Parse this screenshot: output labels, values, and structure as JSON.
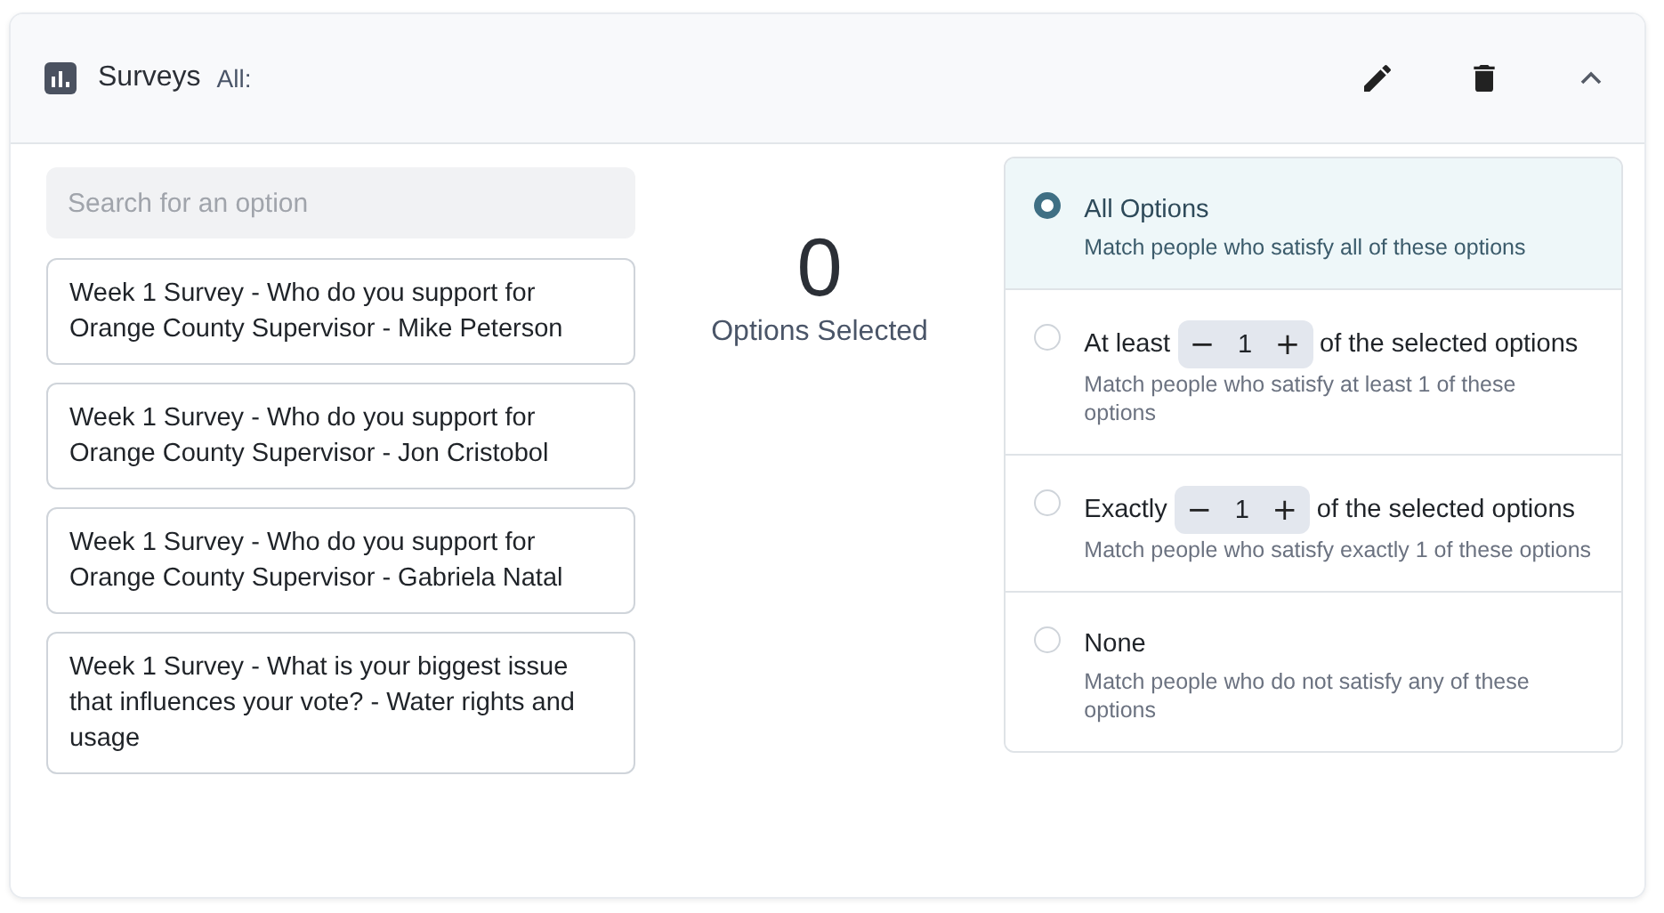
{
  "header": {
    "title": "Surveys",
    "filter": "All:"
  },
  "search": {
    "placeholder": "Search for an option"
  },
  "options": [
    {
      "label": "Week 1 Survey - Who do you support for Orange County Supervisor - Mike Peterson"
    },
    {
      "label": "Week 1 Survey - Who do you support for Orange County Supervisor - Jon Cristobol"
    },
    {
      "label": "Week 1 Survey - Who do you support for Orange County Supervisor - Gabriela Natal"
    },
    {
      "label": "Week 1 Survey - What is your biggest issue that influences your vote? - Water rights and usage"
    }
  ],
  "summary": {
    "count": "0",
    "label": "Options Selected"
  },
  "match_modes": [
    {
      "kind": "plain",
      "selected": true,
      "label": "All Options",
      "description": "Match people who satisfy all of these options"
    },
    {
      "kind": "stepper",
      "selected": false,
      "label": "At least",
      "minus": "−",
      "value": "1",
      "plus": "+",
      "label_after": "of the selected options",
      "description": "Match people who satisfy at least 1 of these options"
    },
    {
      "kind": "stepper",
      "selected": false,
      "label": "Exactly",
      "minus": "−",
      "value": "1",
      "plus": "+",
      "label_after": "of the selected options",
      "description": "Match people who satisfy exactly 1 of these options"
    },
    {
      "kind": "plain",
      "selected": false,
      "label": "None",
      "description": "Match people who do not satisfy any of these options"
    }
  ]
}
